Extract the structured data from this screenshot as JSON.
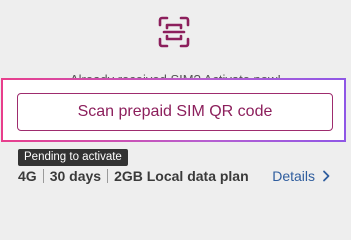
{
  "sim": {
    "scan_icon": "qr-scan-icon",
    "activate_prompt": "Already received SIM? Activate now!",
    "scan_button_label": "Scan prepaid SIM QR code"
  },
  "plan": {
    "status_badge": "Pending to activate",
    "network": "4G",
    "duration": "30 days",
    "data_plan": "2GB Local data plan",
    "details_label": "Details",
    "details_icon": "chevron-right-icon"
  },
  "colors": {
    "accent": "#8c1f5c",
    "link": "#2f5d9e",
    "highlight_gradient": [
      "#e83e8c",
      "#8f57e6"
    ]
  }
}
